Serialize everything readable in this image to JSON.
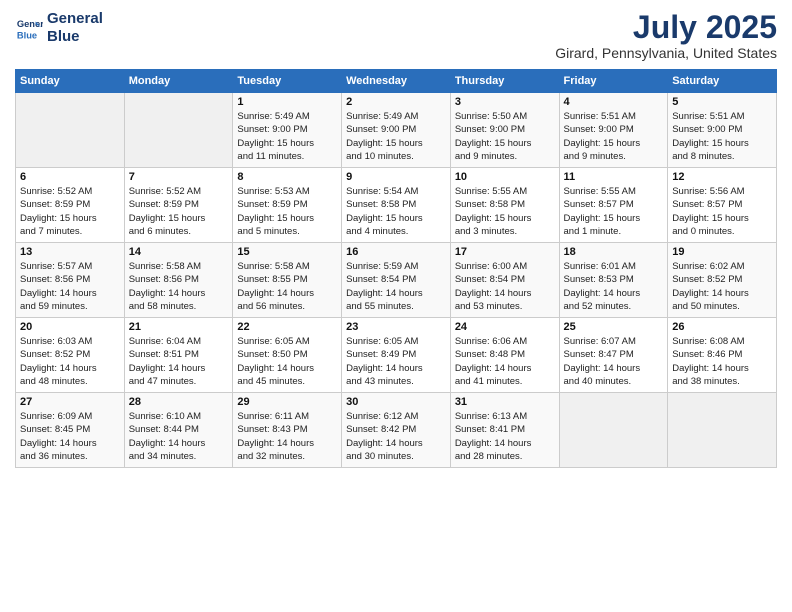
{
  "logo": {
    "line1": "General",
    "line2": "Blue"
  },
  "title": "July 2025",
  "subtitle": "Girard, Pennsylvania, United States",
  "weekdays": [
    "Sunday",
    "Monday",
    "Tuesday",
    "Wednesday",
    "Thursday",
    "Friday",
    "Saturday"
  ],
  "weeks": [
    [
      {
        "day": "",
        "info": ""
      },
      {
        "day": "",
        "info": ""
      },
      {
        "day": "1",
        "info": "Sunrise: 5:49 AM\nSunset: 9:00 PM\nDaylight: 15 hours\nand 11 minutes."
      },
      {
        "day": "2",
        "info": "Sunrise: 5:49 AM\nSunset: 9:00 PM\nDaylight: 15 hours\nand 10 minutes."
      },
      {
        "day": "3",
        "info": "Sunrise: 5:50 AM\nSunset: 9:00 PM\nDaylight: 15 hours\nand 9 minutes."
      },
      {
        "day": "4",
        "info": "Sunrise: 5:51 AM\nSunset: 9:00 PM\nDaylight: 15 hours\nand 9 minutes."
      },
      {
        "day": "5",
        "info": "Sunrise: 5:51 AM\nSunset: 9:00 PM\nDaylight: 15 hours\nand 8 minutes."
      }
    ],
    [
      {
        "day": "6",
        "info": "Sunrise: 5:52 AM\nSunset: 8:59 PM\nDaylight: 15 hours\nand 7 minutes."
      },
      {
        "day": "7",
        "info": "Sunrise: 5:52 AM\nSunset: 8:59 PM\nDaylight: 15 hours\nand 6 minutes."
      },
      {
        "day": "8",
        "info": "Sunrise: 5:53 AM\nSunset: 8:59 PM\nDaylight: 15 hours\nand 5 minutes."
      },
      {
        "day": "9",
        "info": "Sunrise: 5:54 AM\nSunset: 8:58 PM\nDaylight: 15 hours\nand 4 minutes."
      },
      {
        "day": "10",
        "info": "Sunrise: 5:55 AM\nSunset: 8:58 PM\nDaylight: 15 hours\nand 3 minutes."
      },
      {
        "day": "11",
        "info": "Sunrise: 5:55 AM\nSunset: 8:57 PM\nDaylight: 15 hours\nand 1 minute."
      },
      {
        "day": "12",
        "info": "Sunrise: 5:56 AM\nSunset: 8:57 PM\nDaylight: 15 hours\nand 0 minutes."
      }
    ],
    [
      {
        "day": "13",
        "info": "Sunrise: 5:57 AM\nSunset: 8:56 PM\nDaylight: 14 hours\nand 59 minutes."
      },
      {
        "day": "14",
        "info": "Sunrise: 5:58 AM\nSunset: 8:56 PM\nDaylight: 14 hours\nand 58 minutes."
      },
      {
        "day": "15",
        "info": "Sunrise: 5:58 AM\nSunset: 8:55 PM\nDaylight: 14 hours\nand 56 minutes."
      },
      {
        "day": "16",
        "info": "Sunrise: 5:59 AM\nSunset: 8:54 PM\nDaylight: 14 hours\nand 55 minutes."
      },
      {
        "day": "17",
        "info": "Sunrise: 6:00 AM\nSunset: 8:54 PM\nDaylight: 14 hours\nand 53 minutes."
      },
      {
        "day": "18",
        "info": "Sunrise: 6:01 AM\nSunset: 8:53 PM\nDaylight: 14 hours\nand 52 minutes."
      },
      {
        "day": "19",
        "info": "Sunrise: 6:02 AM\nSunset: 8:52 PM\nDaylight: 14 hours\nand 50 minutes."
      }
    ],
    [
      {
        "day": "20",
        "info": "Sunrise: 6:03 AM\nSunset: 8:52 PM\nDaylight: 14 hours\nand 48 minutes."
      },
      {
        "day": "21",
        "info": "Sunrise: 6:04 AM\nSunset: 8:51 PM\nDaylight: 14 hours\nand 47 minutes."
      },
      {
        "day": "22",
        "info": "Sunrise: 6:05 AM\nSunset: 8:50 PM\nDaylight: 14 hours\nand 45 minutes."
      },
      {
        "day": "23",
        "info": "Sunrise: 6:05 AM\nSunset: 8:49 PM\nDaylight: 14 hours\nand 43 minutes."
      },
      {
        "day": "24",
        "info": "Sunrise: 6:06 AM\nSunset: 8:48 PM\nDaylight: 14 hours\nand 41 minutes."
      },
      {
        "day": "25",
        "info": "Sunrise: 6:07 AM\nSunset: 8:47 PM\nDaylight: 14 hours\nand 40 minutes."
      },
      {
        "day": "26",
        "info": "Sunrise: 6:08 AM\nSunset: 8:46 PM\nDaylight: 14 hours\nand 38 minutes."
      }
    ],
    [
      {
        "day": "27",
        "info": "Sunrise: 6:09 AM\nSunset: 8:45 PM\nDaylight: 14 hours\nand 36 minutes."
      },
      {
        "day": "28",
        "info": "Sunrise: 6:10 AM\nSunset: 8:44 PM\nDaylight: 14 hours\nand 34 minutes."
      },
      {
        "day": "29",
        "info": "Sunrise: 6:11 AM\nSunset: 8:43 PM\nDaylight: 14 hours\nand 32 minutes."
      },
      {
        "day": "30",
        "info": "Sunrise: 6:12 AM\nSunset: 8:42 PM\nDaylight: 14 hours\nand 30 minutes."
      },
      {
        "day": "31",
        "info": "Sunrise: 6:13 AM\nSunset: 8:41 PM\nDaylight: 14 hours\nand 28 minutes."
      },
      {
        "day": "",
        "info": ""
      },
      {
        "day": "",
        "info": ""
      }
    ]
  ]
}
